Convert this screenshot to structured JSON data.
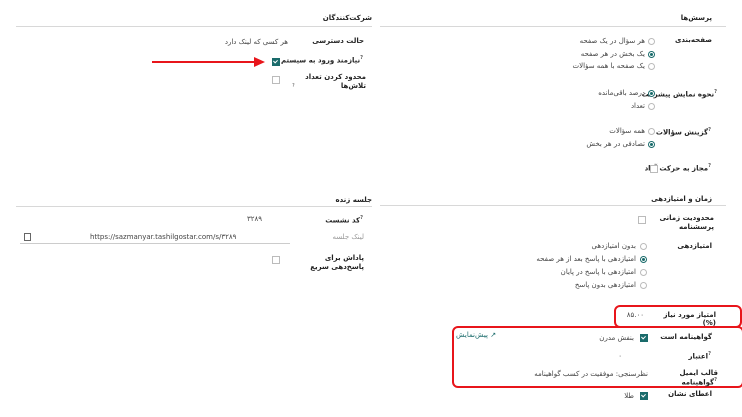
{
  "left": {
    "participants": {
      "title": "شرکت‌کنندگان",
      "access_mode_label": "حالت دسترسی",
      "access_mode_value": "هر کسی که لینک دارد",
      "login_required_label": "نیازمند ورود به سیستم",
      "login_required_checked": true,
      "limit_attempts_label": "محدود کردن تعداد تلاش‌ها",
      "limit_attempts_checked": false
    },
    "live_session": {
      "title": "جلسه زنده",
      "session_code_label": "کد نشست",
      "session_code_value": "۳۲۸۹",
      "session_link_label": "لینک جلسه",
      "session_link_value": "https://sazmanyar.tashilgostar.com/s/۳۲۸۹",
      "fast_reward_label": "پاداش برای پاسخ‌دهی سریع",
      "fast_reward_checked": false
    }
  },
  "right": {
    "questions": {
      "title": "پرسش‌ها",
      "pagination_label": "صفحه‌بندی",
      "pagination_options": [
        "هر سؤال در یک صفحه",
        "یک بخش در هر صفحه",
        "یک صفحه با همه سؤالات"
      ],
      "pagination_selected": 1,
      "progress_label": "نحوه نمایش پیشرفت",
      "progress_options": [
        "درصد باقی‌مانده",
        "تعداد"
      ],
      "progress_selected": 0,
      "selection_label": "گزینش سؤالات",
      "selection_options": [
        "همه سؤالات",
        "تصادفی در هر بخش"
      ],
      "selection_selected": 1,
      "free_nav_label": "مجاز به حرکت آزاد",
      "free_nav_checked": false
    },
    "time_scoring": {
      "title": "زمان و امتیازدهی",
      "time_limit_label": "محدودیت زمانی پرسشنامه",
      "time_limit_checked": false,
      "scoring_label": "امتیازدهی",
      "scoring_options": [
        "بدون امتیازدهی",
        "امتیازدهی با پاسخ بعد از هر صفحه",
        "امتیازدهی با پاسخ در پایان",
        "امتیازدهی بدون پاسخ"
      ],
      "scoring_selected": 1,
      "required_score_label": "امتیاز مورد نیاز (%)",
      "required_score_value": "۸۵.۰۰",
      "is_certification_label": "گواهینامه است",
      "is_certification_checked": true,
      "certification_style": "بنفش مدرن",
      "preview_label": "پیش‌نمایش",
      "credit_label": "اعتبار",
      "credit_value": "۰",
      "cert_email_template_label": "قالب ایمیل گواهینامه",
      "cert_email_template_value": "نظرسنجی: موفقیت در کسب گواهینامه",
      "give_badge_label": "اعطای نشان",
      "give_badge_checked": true,
      "badge_value": "طلا"
    }
  },
  "colors": {
    "accent": "#1a6b6b",
    "annotation": "#e8151b"
  }
}
